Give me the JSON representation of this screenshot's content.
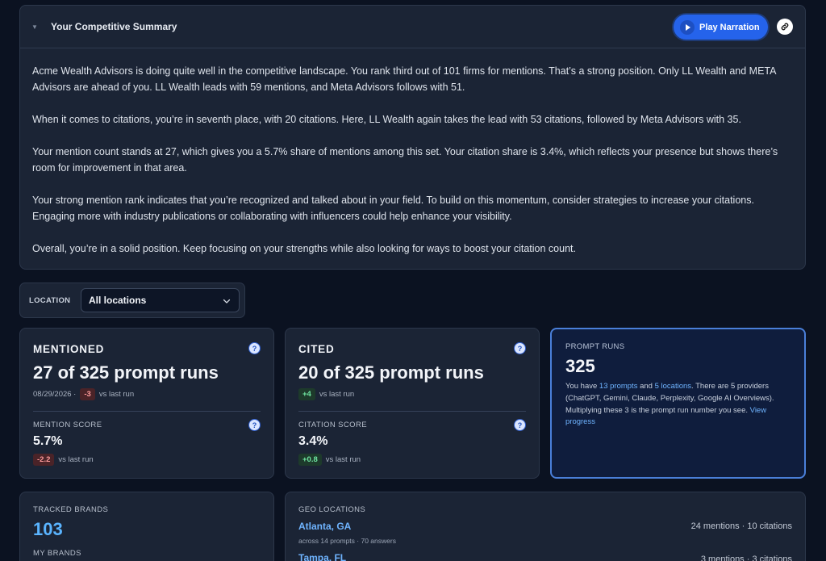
{
  "summary": {
    "title": "Your Competitive Summary",
    "play_label": "Play Narration",
    "paragraphs": [
      "Acme Wealth Advisors is doing quite well in the competitive landscape. You rank third out of 101 firms for mentions. That’s a strong position. Only LL Wealth and META Advisors are ahead of you. LL Wealth leads with 59 mentions, and Meta Advisors follows with 51.",
      "When it comes to citations, you’re in seventh place, with 20 citations. Here, LL Wealth again takes the lead with 53 citations, followed by Meta Advisors with 35.",
      "Your mention count stands at 27, which gives you a 5.7% share of mentions among this set. Your citation share is 3.4%, which reflects your presence but shows there’s room for improvement in that area.",
      "Your strong mention rank indicates that you’re recognized and talked about in your field. To build on this momentum, consider strategies to increase your citations. Engaging more with industry publications or collaborating with influencers could help enhance your visibility.",
      "Overall, you’re in a solid position. Keep focusing on your strengths while also looking for ways to boost your citation count."
    ]
  },
  "location": {
    "label": "LOCATION",
    "selected": "All locations"
  },
  "mentioned": {
    "label": "MENTIONED",
    "value": "27 of 325 prompt runs",
    "date": "08/29/2026 ·",
    "delta": "-3",
    "vs": "vs last run",
    "score_label": "MENTION SCORE",
    "score": "5.7%",
    "score_delta": "-2.2",
    "score_vs": "vs last run"
  },
  "cited": {
    "label": "CITED",
    "value": "20 of 325 prompt runs",
    "delta": "+4",
    "vs": "vs last run",
    "score_label": "CITATION SCORE",
    "score": "3.4%",
    "score_delta": "+0.8",
    "score_vs": "vs last run"
  },
  "prompt_runs": {
    "label": "PROMPT RUNS",
    "value": "325",
    "desc_1": "You have ",
    "prompts_link": "13 prompts",
    "desc_2": " and ",
    "locations_link": "5 locations",
    "desc_3": ". There are 5 providers (ChatGPT, Gemini, Claude, Perplexity, Google AI Overviews). Multiplying these 3 is the prompt run number you see. ",
    "progress_link": "View progress"
  },
  "tracked": {
    "label": "TRACKED BRANDS",
    "value": "103",
    "sub": "MY BRANDS"
  },
  "geo": {
    "label": "GEO LOCATIONS",
    "rows": [
      {
        "city": "Atlanta, GA",
        "meta": "across 14 prompts · 70 answers",
        "stats": "24 mentions · 10 citations"
      },
      {
        "city": "Tampa, FL",
        "meta": "",
        "stats": "3 mentions · 3 citations"
      }
    ]
  }
}
